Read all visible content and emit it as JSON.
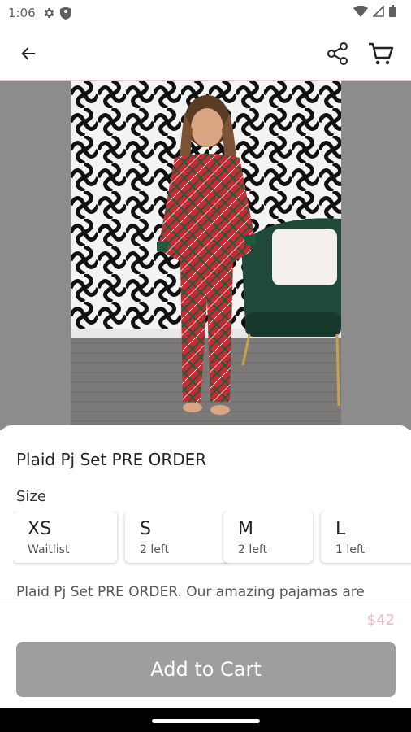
{
  "status": {
    "time": "1:06"
  },
  "product": {
    "title": "Plaid Pj Set PRE ORDER",
    "size_label": "Size",
    "sizes": [
      {
        "size": "XS",
        "availability": "Waitlist"
      },
      {
        "size": "S",
        "availability": "2 left"
      },
      {
        "size": "M",
        "availability": "2 left"
      },
      {
        "size": "L",
        "availability": "1 left"
      }
    ],
    "description": "Plaid Pj Set PRE ORDER. Our amazing pajamas are",
    "price": "$42"
  },
  "actions": {
    "add_to_cart": "Add to Cart"
  },
  "colors": {
    "button": "#9e9e9e",
    "price": "#f3b6c6",
    "plaid_red": "#c62b33",
    "chair_green": "#1f4a3a"
  }
}
